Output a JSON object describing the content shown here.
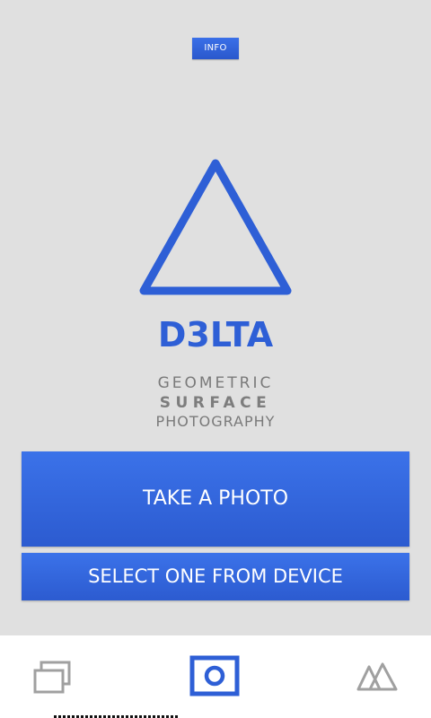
{
  "header": {
    "info_label": "INFO"
  },
  "brand": {
    "title": "D3LTA",
    "tagline": [
      "GEOMETRIC",
      "SURFACE",
      "PHOTOGRAPHY"
    ],
    "logo_icon": "triangle-logo-icon",
    "accent_color": "#2e5fd6"
  },
  "actions": {
    "take_photo_label": "TAKE A PHOTO",
    "select_device_label": "SELECT ONE FROM DEVICE"
  },
  "bottom_nav": {
    "items": [
      {
        "icon": "gallery-icon"
      },
      {
        "icon": "camera-icon",
        "selected": true
      },
      {
        "icon": "mountain-icon"
      }
    ],
    "active_color": "#2e5fd6",
    "inactive_color": "#a0a0a0"
  }
}
